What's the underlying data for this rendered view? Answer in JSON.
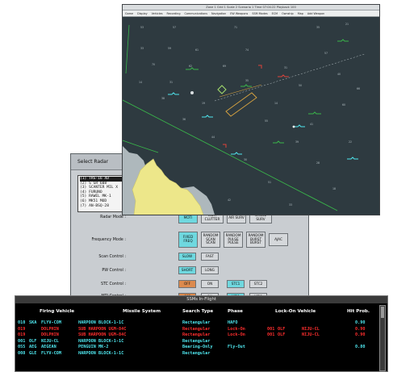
{
  "radar_window": {
    "title": "Select Radar",
    "radars": [
      "(1) TRS-16 XD",
      "(2) S GR 608",
      "(3) SCANTER MIL X",
      "(4) FURUNO",
      "(5) RAWEL MK-1",
      "(6) MK51 MOD",
      "(7) AN-BSQ-28"
    ],
    "selected_index": 0,
    "controls": {
      "radar_mode": {
        "label": "Radar Mode :",
        "buttons": [
          "MOTI",
          "MOTI CLUTTER",
          "AIR SURV",
          "RANGE SURV"
        ],
        "active": [
          0
        ]
      },
      "frequency_mode": {
        "label": "Frequency Mode :",
        "buttons": [
          "FIXED FREQ",
          "RANDOM SCAN SCAN",
          "RANDOM PULSE PULSE",
          "RANDOM BURST BURST",
          "AJAC"
        ],
        "active": [
          0
        ]
      },
      "scan_control": {
        "label": "Scan Control :",
        "buttons": [
          "SLOW",
          "FAST"
        ],
        "active": [
          0
        ]
      },
      "pw_control": {
        "label": "PW Control :",
        "buttons": [
          "SHORT",
          "LONG"
        ],
        "active": [
          0
        ]
      },
      "stc_control": {
        "label": "STC Control :",
        "buttons": [
          "OFF",
          "ON",
          "STC1",
          "STC2"
        ],
        "active": [
          0,
          2
        ]
      },
      "mti_control": {
        "label": "MTI Control :",
        "buttons": [
          "OFF",
          "ON",
          "MTI1",
          "MTI2"
        ],
        "active": [
          0,
          2
        ]
      }
    }
  },
  "map_window": {
    "title_bar": "Zone 1    Grid 1    Scale 2    Scenario 1    Time 07:04:22    Playback 100   ",
    "menu": [
      "Game",
      "Display",
      "Vehicles",
      "Recording",
      "Communications",
      "Navigation",
      "EW Weapons",
      "SSM Modes",
      "ECM",
      "Ownship",
      "Map",
      "Add Weapon"
    ],
    "colors": {
      "sea": "#2e3a40",
      "land": "#ede78a",
      "shallow": "#aeb8bc",
      "grid_numbers": "#b3bfc3"
    }
  },
  "ssm_window": {
    "title": "SSMs In-Flight",
    "headers": [
      "Firing Vehicle",
      "Missile System",
      "Search Type",
      "Phase",
      "Lock-On Vehicle",
      "Hit Prob."
    ],
    "rows": [
      {
        "id": "010",
        "code": "SKA",
        "vehicle": "FLYV-COM",
        "missile": "HARPOON BLOCK-1-1C",
        "search": "Rectangular",
        "phase": "HAFO",
        "lock_id": "",
        "lock_code": "",
        "lock_vehicle": "",
        "prob": "0.90",
        "color": "#4fe6ee"
      },
      {
        "id": "019",
        "code": "",
        "vehicle": "DOLPHIN",
        "missile": "SUB HARPOON UGM-84C",
        "search": "Rectangular",
        "phase": "Lock-On",
        "lock_id": "001",
        "lock_code": "OLF",
        "lock_vehicle": "NIJU-CL",
        "prob": "0.90",
        "color": "#ff2e2e"
      },
      {
        "id": "019",
        "code": "",
        "vehicle": "DOLPHIN",
        "missile": "SUB HARPOON UGM-84C",
        "search": "Rectangular",
        "phase": "Lock-On",
        "lock_id": "001",
        "lock_code": "OLF",
        "lock_vehicle": "NIJU-CL",
        "prob": "0.90",
        "color": "#ff2e2e"
      },
      {
        "id": "001",
        "code": "OLF",
        "vehicle": "NIJU-CL",
        "missile": "HARPOON BLOCK-1-1C",
        "search": "Rectangular",
        "phase": "",
        "lock_id": "",
        "lock_code": "",
        "lock_vehicle": "",
        "prob": "",
        "color": "#4fe6ee"
      },
      {
        "id": "055",
        "code": "AEG",
        "vehicle": "AEGEAN",
        "missile": "PENGUIN MK-2",
        "search": "Bearing-Only",
        "phase": "Fly-Out",
        "lock_id": "",
        "lock_code": "",
        "lock_vehicle": "",
        "prob": "0.80",
        "color": "#4fe6ee"
      },
      {
        "id": "008",
        "code": "GLE",
        "vehicle": "FLYV-COM",
        "missile": "HARPOON BLOCK-1-1C",
        "search": "Rectangular",
        "phase": "",
        "lock_id": "",
        "lock_code": "",
        "lock_vehicle": "",
        "prob": "",
        "color": "#4fe6ee"
      }
    ]
  }
}
